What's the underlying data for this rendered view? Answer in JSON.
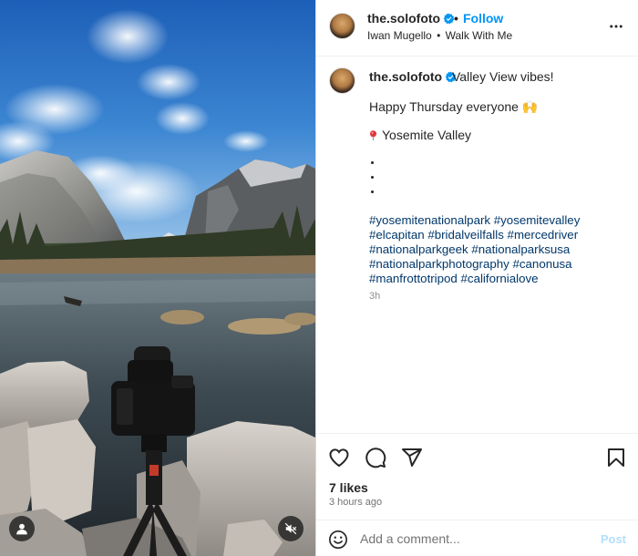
{
  "post": {
    "username": "the.solofoto",
    "verified": true,
    "follow_label": "Follow",
    "music": {
      "artist": "Iwan Mugello",
      "separator": "•",
      "title": "Walk With Me"
    },
    "caption": {
      "first_line": "Valley View vibes!",
      "greeting": "Happy Thursday everyone 🙌",
      "location": "Yosemite Valley",
      "hashtag_lines": [
        [
          "#yosemitenationalpark",
          "#yosemitevalley"
        ],
        [
          "#elcapitan",
          "#bridalveilfalls",
          "#mercedriver"
        ],
        [
          "#nationalparkgeek",
          "#nationalparksusa"
        ],
        [
          "#nationalparkphotography",
          "#canonusa"
        ],
        [
          "#manfrottotripod",
          "#californialove"
        ]
      ],
      "time": "3h"
    },
    "likes": "7 likes",
    "posted_ago": "3 hours ago",
    "comment": {
      "placeholder": "Add a comment...",
      "value": "",
      "post_label": "Post"
    }
  },
  "icons": {
    "more": "more-options-icon",
    "like": "heart-icon",
    "comment": "comment-icon",
    "share": "share-icon",
    "save": "bookmark-icon",
    "emoji": "emoji-icon",
    "tagged_users": "user-icon",
    "mute": "audio-muted-icon",
    "verified": "verified-badge-icon",
    "location": "location-pin-icon"
  },
  "colors": {
    "accent": "#0095f6",
    "hashtag": "#00376b",
    "muted_text": "#737373",
    "post_disabled": "#b2dffc"
  }
}
